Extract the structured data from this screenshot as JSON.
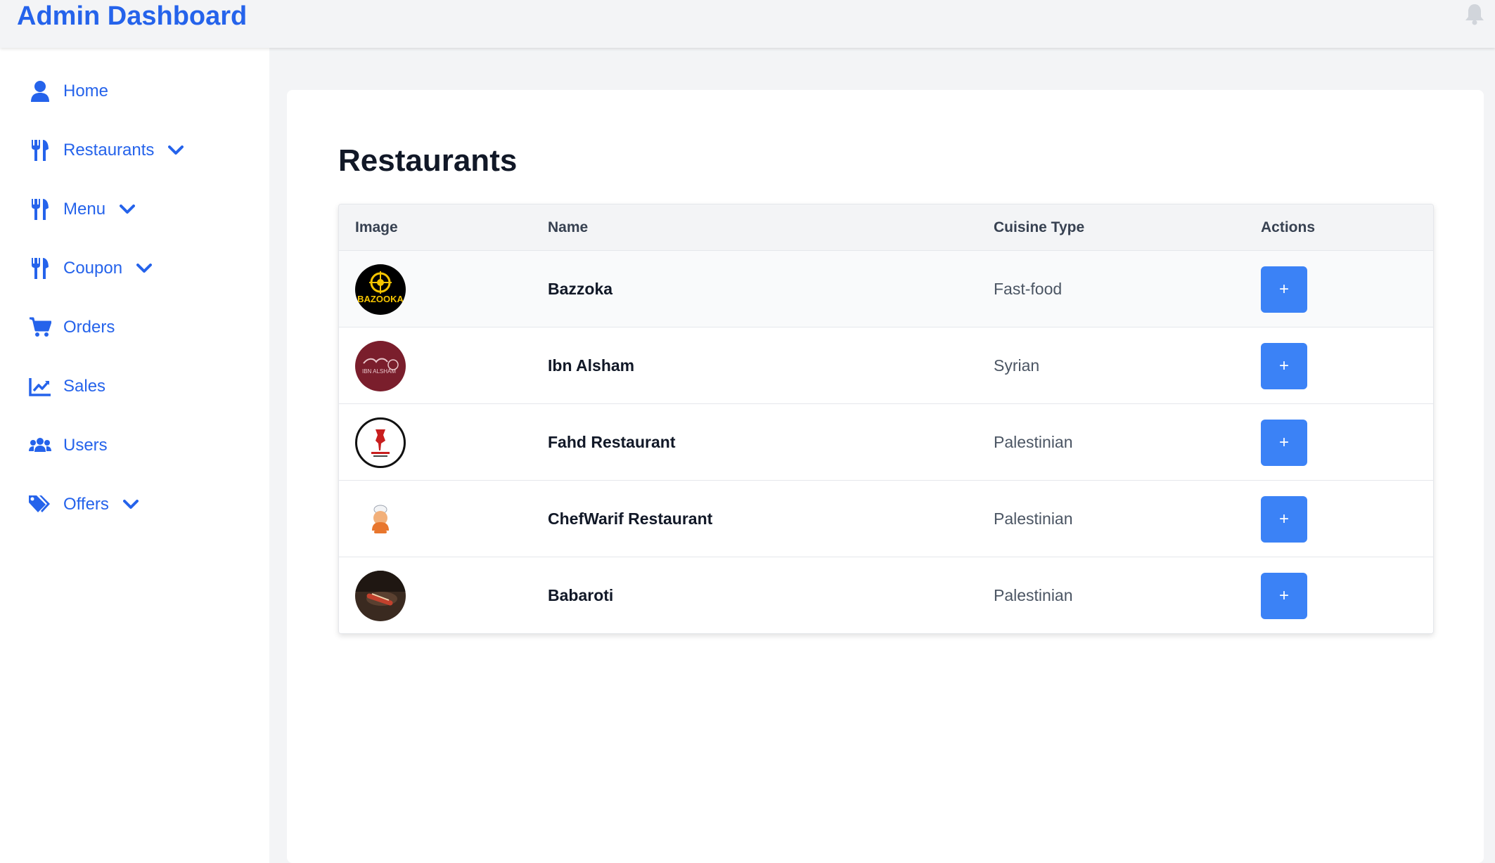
{
  "header": {
    "title": "Admin Dashboard",
    "notification_icon": "bell-icon"
  },
  "sidebar": {
    "items": [
      {
        "label": "Home",
        "icon": "user-icon",
        "expandable": false
      },
      {
        "label": "Restaurants",
        "icon": "utensils-icon",
        "expandable": true
      },
      {
        "label": "Menu",
        "icon": "utensils-icon",
        "expandable": true
      },
      {
        "label": "Coupon",
        "icon": "utensils-icon",
        "expandable": true
      },
      {
        "label": "Orders",
        "icon": "cart-icon",
        "expandable": false
      },
      {
        "label": "Sales",
        "icon": "chart-line-icon",
        "expandable": false
      },
      {
        "label": "Users",
        "icon": "users-icon",
        "expandable": false
      },
      {
        "label": "Offers",
        "icon": "tags-icon",
        "expandable": true
      }
    ]
  },
  "main": {
    "title": "Restaurants",
    "table": {
      "columns": [
        "Image",
        "Name",
        "Cuisine Type",
        "Actions"
      ],
      "rows": [
        {
          "name": "Bazzoka",
          "cuisine": "Fast-food",
          "logo_text": "BAZOOKA",
          "action": "+"
        },
        {
          "name": "Ibn Alsham",
          "cuisine": "Syrian",
          "logo_text": "IBN ALSHAM",
          "action": "+"
        },
        {
          "name": "Fahd Restaurant",
          "cuisine": "Palestinian",
          "logo_text": "",
          "action": "+"
        },
        {
          "name": "ChefWarif Restaurant",
          "cuisine": "Palestinian",
          "logo_text": "",
          "action": "+"
        },
        {
          "name": "Babaroti",
          "cuisine": "Palestinian",
          "logo_text": "",
          "action": "+"
        }
      ]
    }
  },
  "colors": {
    "accent": "#2563eb",
    "button": "#3b82f6",
    "background": "#f3f4f6"
  }
}
